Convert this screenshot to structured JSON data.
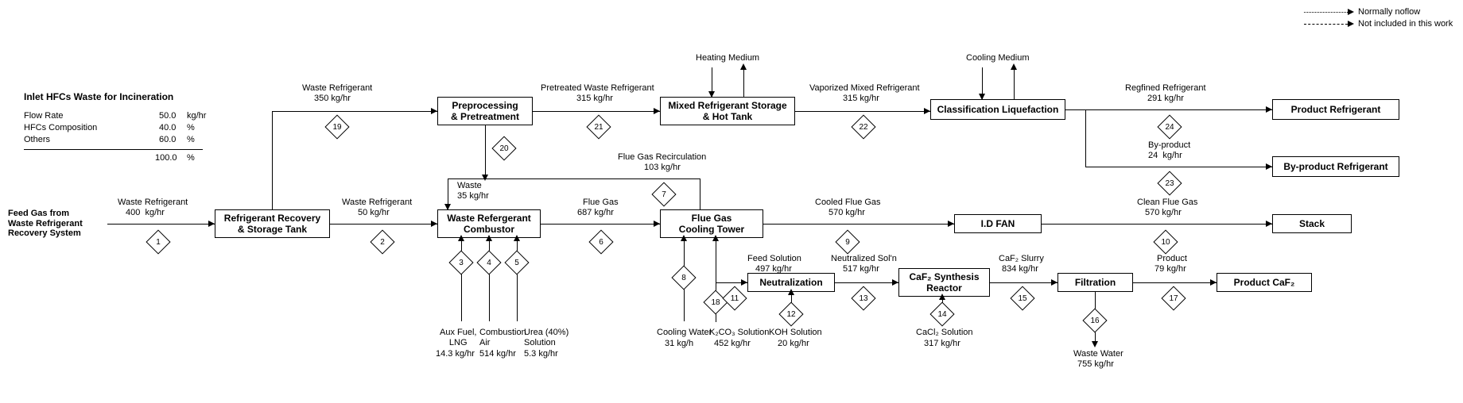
{
  "legend": {
    "normally_noflow": "Normally noflow",
    "not_included": "Not included in this work"
  },
  "inlet": {
    "title": "Inlet HFCs Waste for Incineration",
    "rows": [
      {
        "k": "Flow Rate",
        "v": "50.0",
        "u": "kg/hr"
      },
      {
        "k": "HFCs Composition",
        "v": "40.0",
        "u": "%"
      },
      {
        "k": "Others",
        "v": "60.0",
        "u": "%"
      }
    ],
    "total_v": "100.0",
    "total_u": "%"
  },
  "feed_source": "Feed Gas from\nWaste Refrigerant\nRecovery System",
  "blocks": {
    "recovery": "Refrigerant Recovery\n& Storage Tank",
    "prepro": "Preprocessing\n& Pretreatment",
    "mixstore": "Mixed Refrigerant Storage\n& Hot Tank",
    "classliq": "Classification Liquefaction",
    "prod_ref": "Product Refrigerant",
    "bypr_ref": "By-product Refrigerant",
    "combustor": "Waste Refergerant\nCombustor",
    "cooltower": "Flue Gas\nCooling Tower",
    "idfan": "I.D FAN",
    "stack": "Stack",
    "neut": "Neutralization",
    "caf2react": "CaF₂ Synthesis\nReactor",
    "filt": "Filtration",
    "prod_caf2": "Product CaF₂"
  },
  "streams": {
    "1": {
      "name": "Waste Refrigerant",
      "rate": "400",
      "unit": "kg/hr"
    },
    "2": {
      "name": "Waste Refrigerant",
      "rate": "50",
      "unit": "kg/hr"
    },
    "3": {
      "name": "Aux Fuel,\nLNG",
      "rate": "14.3",
      "unit": "kg/hr"
    },
    "4": {
      "name": "Combustion\nAir",
      "rate": "514",
      "unit": "kg/hr"
    },
    "5": {
      "name": "Urea (40%)\nSolution",
      "rate": "5.3",
      "unit": "kg/hr"
    },
    "6": {
      "name": "Flue Gas",
      "rate": "687",
      "unit": "kg/hr"
    },
    "7": {
      "name": "Flue Gas Recirculation",
      "rate": "103",
      "unit": "kg/hr"
    },
    "8": {
      "name": "Cooling Water",
      "rate": "31",
      "unit": "kg/h"
    },
    "9": {
      "name": "Cooled Flue Gas",
      "rate": "570",
      "unit": "kg/hr"
    },
    "10": {
      "name": "Clean Flue Gas",
      "rate": "570",
      "unit": "kg/hr"
    },
    "11": {
      "name": "Feed Solution",
      "rate": "497",
      "unit": "kg/hr"
    },
    "12": {
      "name": "KOH Solution",
      "rate": "20",
      "unit": "kg/hr"
    },
    "13": {
      "name": "Neutralized Sol'n",
      "rate": "517",
      "unit": "kg/hr"
    },
    "14": {
      "name": "CaCl₂ Solution",
      "rate": "317",
      "unit": "kg/hr"
    },
    "15": {
      "name": "CaF₂ Slurry",
      "rate": "834",
      "unit": "kg/hr"
    },
    "16": {
      "name": "Waste Water",
      "rate": "755",
      "unit": "kg/hr"
    },
    "17": {
      "name": "Product",
      "rate": "79",
      "unit": "kg/hr"
    },
    "18": {
      "name": "K₂CO₃ Solution",
      "rate": "452",
      "unit": "kg/hr"
    },
    "19": {
      "name": "Waste Refrigerant",
      "rate": "350",
      "unit": "kg/hr"
    },
    "20": {
      "name": "Waste",
      "rate": "35",
      "unit": "kg/hr"
    },
    "21": {
      "name": "Pretreated Waste Refrigerant",
      "rate": "315",
      "unit": "kg/hr"
    },
    "22": {
      "name": "Vaporized Mixed Refrigerant",
      "rate": "315",
      "unit": "kg/hr"
    },
    "23": {
      "name": "By-product",
      "rate": "24",
      "unit": "kg/hr"
    },
    "24": {
      "name": "Regfined Refrigerant",
      "rate": "291",
      "unit": "kg/hr"
    }
  },
  "misc": {
    "heating_medium": "Heating Medium",
    "cooling_medium": "Cooling Medium"
  }
}
